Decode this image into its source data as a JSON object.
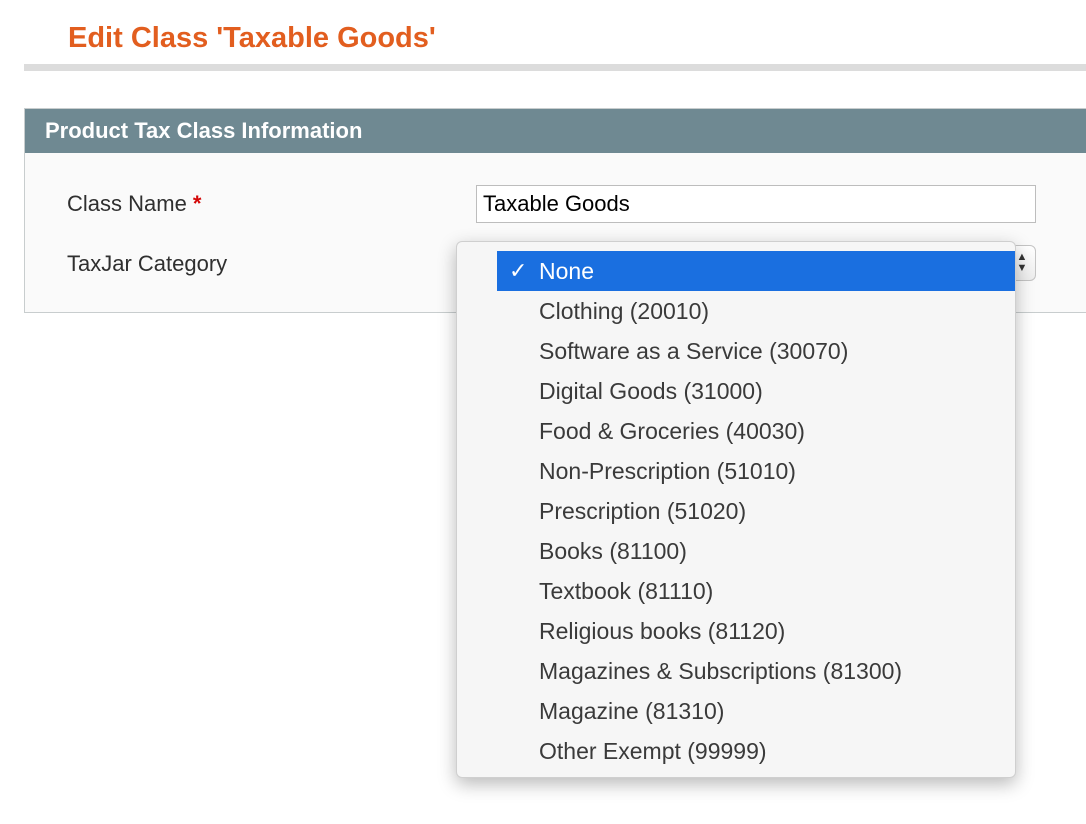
{
  "page": {
    "title": "Edit Class 'Taxable Goods'"
  },
  "fieldset": {
    "header": "Product Tax Class Information",
    "class_name": {
      "label": "Class Name",
      "required_mark": "*",
      "value": "Taxable Goods"
    },
    "taxjar_category": {
      "label": "TaxJar Category",
      "selected": "None",
      "checkmark": "✓",
      "options": [
        "None",
        "Clothing (20010)",
        "Software as a Service (30070)",
        "Digital Goods (31000)",
        "Food & Groceries (40030)",
        "Non-Prescription (51010)",
        "Prescription (51020)",
        "Books (81100)",
        "Textbook (81110)",
        "Religious books (81120)",
        "Magazines & Subscriptions (81300)",
        "Magazine (81310)",
        "Other Exempt (99999)"
      ]
    }
  },
  "colors": {
    "title": "#e25e1f",
    "header_bg": "#6f8992",
    "selected_bg": "#1a6fe0",
    "required": "#d40707"
  }
}
